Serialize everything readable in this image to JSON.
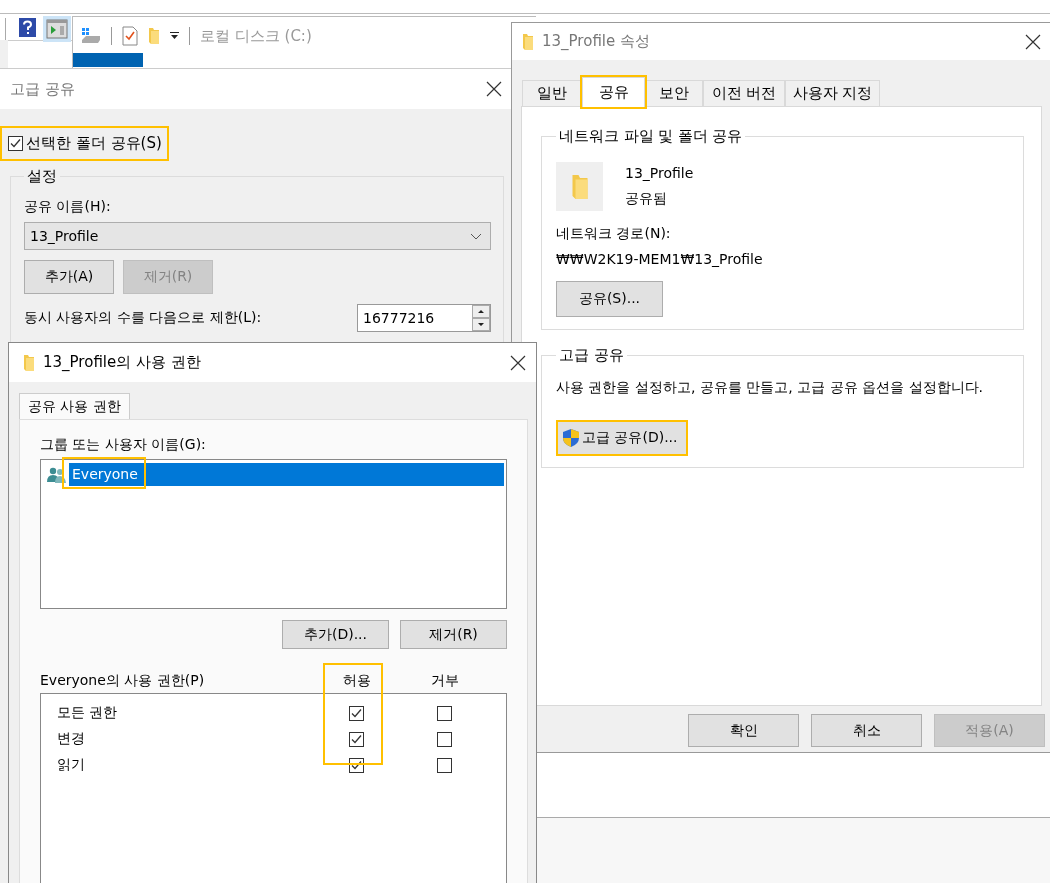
{
  "explorer": {
    "title": "로컬 디스크 (C:)"
  },
  "advanced_sharing": {
    "title": "고급 공유",
    "share_checkbox": {
      "label": "선택한 폴더 공유(S)",
      "checked": true,
      "highlighted": true
    },
    "settings_group": "설정",
    "share_name_label": "공유 이름(H):",
    "share_name": "13_Profile",
    "buttons": [
      {
        "label": "추가(A)",
        "disabled": false
      },
      {
        "label": "제거(R)",
        "disabled": true
      }
    ],
    "user_limit_label": "동시 사용자의 수를 다음으로 제한(L):",
    "user_limit": "16777216"
  },
  "permissions": {
    "title": "13_Profile의 사용 권한",
    "tabs": [
      {
        "label": "공유 사용 권한",
        "selected": true
      }
    ],
    "users_label": "그룹 또는 사용자 이름(G):",
    "users": [
      {
        "name": "Everyone",
        "selected": true,
        "highlighted": true
      }
    ],
    "buttons": [
      {
        "label": "추가(D)..."
      },
      {
        "label": "제거(R)"
      }
    ],
    "permissions_label": "Everyone의 사용 권한(P)",
    "columns": [
      {
        "label": "허용",
        "highlighted": true
      },
      {
        "label": "거부",
        "highlighted": false
      }
    ],
    "rows": [
      {
        "name": "모든 권한",
        "allow": true,
        "deny": false
      },
      {
        "name": "변경",
        "allow": true,
        "deny": false
      },
      {
        "name": "읽기",
        "allow": true,
        "deny": false
      }
    ]
  },
  "properties": {
    "title": "13_Profile 속성",
    "tabs": [
      {
        "label": "일반",
        "selected": false,
        "highlighted": false
      },
      {
        "label": "공유",
        "selected": true,
        "highlighted": true
      },
      {
        "label": "보안",
        "selected": false,
        "highlighted": false
      },
      {
        "label": "이전 버전",
        "selected": false,
        "highlighted": false
      },
      {
        "label": "사용자 지정",
        "selected": false,
        "highlighted": false
      }
    ],
    "network_group": "네트워크 파일 및 폴더 공유",
    "folder_name": "13_Profile",
    "share_status": "공유됨",
    "network_path_label": "네트워크 경로(N):",
    "network_path": "₩₩W2K19-MEM1₩13_Profile",
    "share_button": "공유(S)...",
    "advanced_group": "고급 공유",
    "advanced_description": "사용 권한을 설정하고, 공유를 만들고, 고급 공유 옵션을 설정합니다.",
    "advanced_button": {
      "label": "고급 공유(D)...",
      "highlighted": true
    },
    "buttons": [
      {
        "label": "확인",
        "disabled": false
      },
      {
        "label": "취소",
        "disabled": false
      },
      {
        "label": "적용(A)",
        "disabled": true
      }
    ]
  }
}
